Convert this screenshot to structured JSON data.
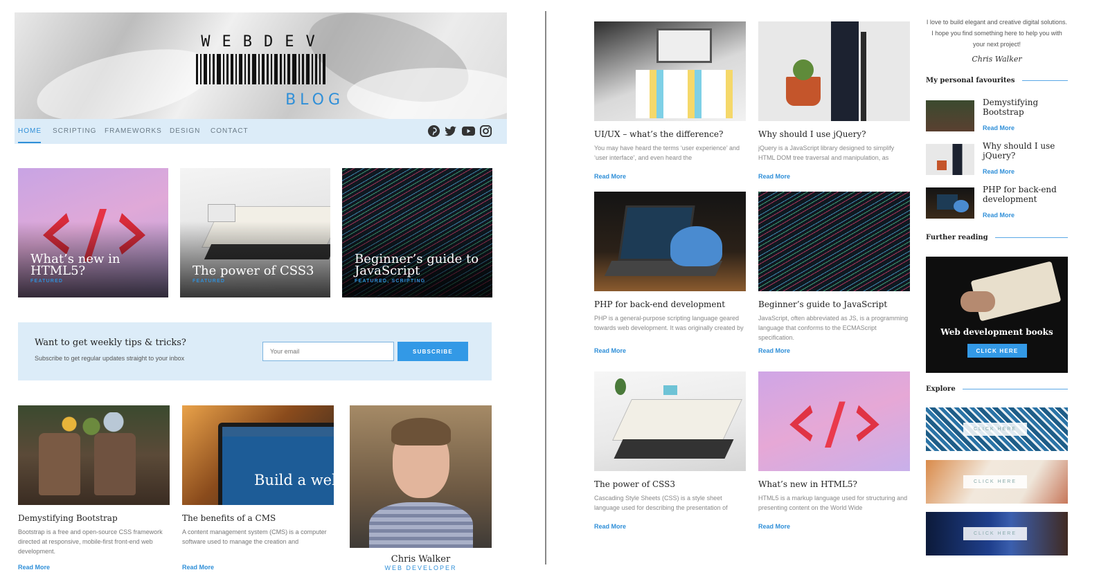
{
  "logo": {
    "top": "WEBDEV",
    "bottom": "BLOG"
  },
  "nav": {
    "items": [
      "HOME",
      "SCRIPTING",
      "FRAMEWORKS",
      "DESIGN",
      "CONTACT"
    ],
    "active": "HOME",
    "social_icons": [
      "pinterest-icon",
      "twitter-icon",
      "youtube-icon",
      "instagram-icon"
    ]
  },
  "featured": [
    {
      "title": "What’s new in HTML5?",
      "tag": "FEATURED"
    },
    {
      "title": "The power of CSS3",
      "tag": "FEATURED"
    },
    {
      "title": "Beginner’s guide to JavaScript",
      "tag": "FEATURED, SCRIPTING"
    }
  ],
  "newsletter": {
    "title": "Want to get weekly tips & tricks?",
    "subtitle": "Subscribe to get regular updates straight to your inbox",
    "placeholder": "Your email",
    "button": "SUBSCRIBE"
  },
  "left_posts": [
    {
      "title": "Demystifying Bootstrap",
      "excerpt": "Bootstrap is a free and open-source CSS framework directed at responsive, mobile-first front-end web development.",
      "read_more": "Read More"
    },
    {
      "title": "The benefits of a CMS",
      "excerpt": "A content management system (CMS) is a computer software used to manage the creation and",
      "read_more": "Read More",
      "image_text": "Build a web build a mov"
    }
  ],
  "author": {
    "name": "Chris Walker",
    "role": "WEB DEVELOPER"
  },
  "grid_posts": [
    {
      "title": "UI/UX – what’s the difference?",
      "excerpt": "You may have heard the terms ‘user experience’ and ‘user interface’, and even heard the",
      "read_more": "Read More"
    },
    {
      "title": "Why should I use jQuery?",
      "excerpt": "jQuery is a JavaScript library designed to simplify HTML DOM tree traversal and manipulation, as",
      "read_more": "Read More"
    },
    {
      "title": "PHP for back-end development",
      "excerpt": "PHP is a general-purpose scripting language geared towards web development. It was originally created by",
      "read_more": "Read More"
    },
    {
      "title": "Beginner’s guide to JavaScript",
      "excerpt": "JavaScript, often abbreviated as JS, is a programming language that conforms to the ECMAScript specification.",
      "read_more": "Read More"
    },
    {
      "title": "The power of CSS3",
      "excerpt": "Cascading Style Sheets (CSS) is a style sheet language used for describing the presentation of",
      "read_more": "Read More"
    },
    {
      "title": "What’s new in HTML5?",
      "excerpt": "HTML5 is a markup language used for structuring and presenting content on the World Wide",
      "read_more": "Read More"
    }
  ],
  "sidebar": {
    "bio": "I love to build elegant and creative digital solutions. I hope you find something here to help you with your next project!",
    "signature": "Chris Walker",
    "favourites_heading": "My personal favourites",
    "favourites": [
      {
        "title": "Demystifying Bootstrap",
        "read_more": "Read More"
      },
      {
        "title": "Why should I use jQuery?",
        "read_more": "Read More"
      },
      {
        "title": "PHP for back-end development",
        "read_more": "Read More"
      }
    ],
    "further_heading": "Further reading",
    "promo_title": "Web development books",
    "promo_button": "CLICK HERE",
    "explore_heading": "Explore",
    "explore_buttons": [
      "CLICK HERE",
      "CLICK HERE",
      "CLICK HERE"
    ]
  },
  "colors": {
    "accent": "#2f8fd8",
    "nav_bg": "#dcecf8",
    "button": "#3399e6"
  }
}
